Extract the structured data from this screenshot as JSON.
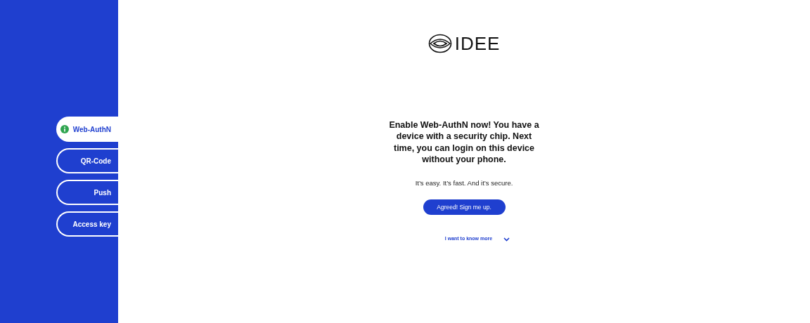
{
  "sidebar": {
    "tabs": [
      {
        "label": "Web-AuthN",
        "selected": true
      },
      {
        "label": "QR-Code",
        "selected": false
      },
      {
        "label": "Push",
        "selected": false
      },
      {
        "label": "Access key",
        "selected": false
      }
    ]
  },
  "logo": {
    "text": "IDEE"
  },
  "main": {
    "heading": "Enable Web-AuthN now! You have a device with a security chip. Next time, you can login on this device without your phone.",
    "subtext": "It’s easy. It’s fast. And it’s secure.",
    "button": "Agreed! Sign me up.",
    "more_link": "I want to know more"
  }
}
